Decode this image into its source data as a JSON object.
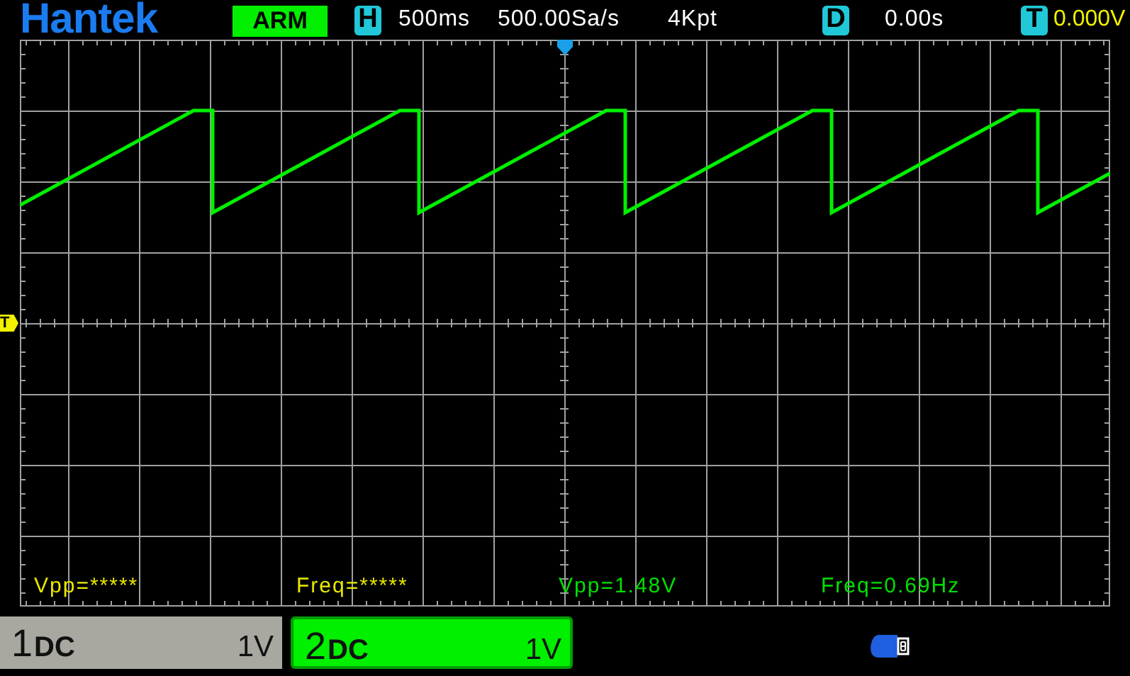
{
  "brand": "Hantek",
  "status": "ARM",
  "timebase": {
    "badge": "H",
    "value": "500ms"
  },
  "sample_rate": "500.00Sa/s",
  "memory_depth": "4Kpt",
  "delay": {
    "badge": "D",
    "value": "0.00s"
  },
  "trigger": {
    "badge": "T",
    "value": "0.000V"
  },
  "trigger_marker": "T",
  "measurements": [
    {
      "text": "Vpp=*****",
      "color": "#e8e800"
    },
    {
      "text": "Freq=*****",
      "color": "#e8e800"
    },
    {
      "text": "Vpp=1.48V",
      "color": "#00e000"
    },
    {
      "text": "Freq=0.69Hz",
      "color": "#00e000"
    }
  ],
  "channels": [
    {
      "number": "1",
      "coupling": "DC",
      "scale": "1V",
      "color": "#a8a8a0"
    },
    {
      "number": "2",
      "coupling": "DC",
      "scale": "1V",
      "color": "#00f000"
    }
  ]
}
